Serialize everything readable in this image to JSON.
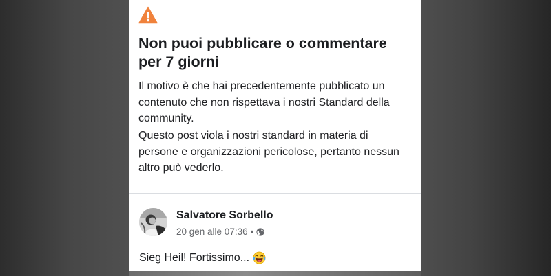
{
  "notice": {
    "icon": "warning-triangle-icon",
    "icon_color": "#F0823C",
    "title": "Non puoi pubblicare o commentare per 7 giorni",
    "reason_text": "Il motivo è che hai precedentemente pubblicato un contenuto che non rispettava i nostri Standard della community.",
    "violation_text": "Questo post viola i nostri standard in materia di persone e organizzazioni pericolose, pertanto nessun altro può vederlo."
  },
  "post": {
    "author_name": "Salvatore Sorbello",
    "timestamp": "20 gen alle 07:36",
    "separator": "•",
    "audience_icon": "globe-icon",
    "text": "Sieg Heil! Fortissimo...",
    "emoji": "tears-of-joy-emoji"
  }
}
